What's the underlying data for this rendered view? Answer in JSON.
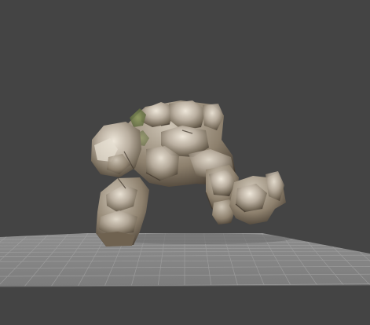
{
  "viewport": {
    "background_color": "#444444",
    "floor_color": "#8f8f8f",
    "floor_grid_color": "#a4a4a4",
    "model_primary_color": "#b7ad9e",
    "model_shadow_color": "#4a4034",
    "model_highlight_color": "#e3dccf",
    "moss_color": "#7d8a55"
  },
  "scene": {
    "object_icon": "rock-golem-model",
    "floor_icon": "ground-grid"
  }
}
